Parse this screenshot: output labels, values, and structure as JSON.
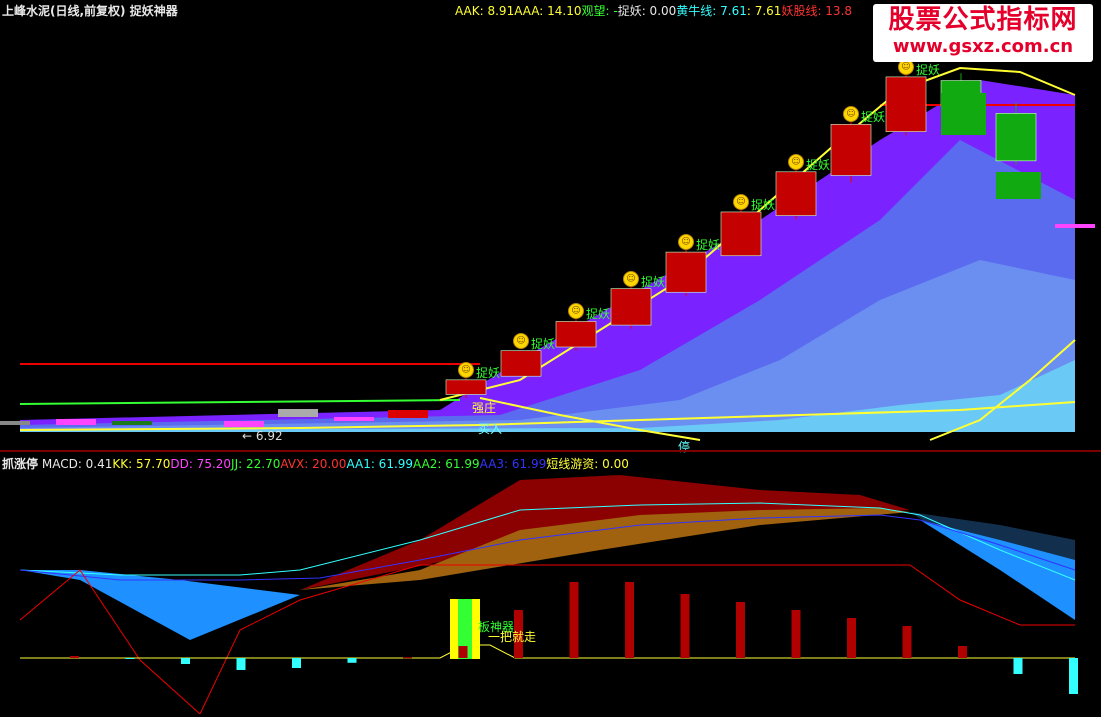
{
  "main_panel": {
    "title": "上峰水泥(日线,前复权) 捉妖神器",
    "indicators": [
      {
        "label": "AAK:",
        "value": "8.91",
        "color": "#ffff33"
      },
      {
        "label": "AAA:",
        "value": "14.10",
        "color": "#ffff33"
      },
      {
        "label": "观望:",
        "value": "-",
        "color": "#33ff33"
      },
      {
        "label": "捉妖:",
        "value": "0.00",
        "color": "#e8e8e8"
      },
      {
        "label": "黄牛线:",
        "value": "7.61",
        "color": "#33ffff"
      },
      {
        "label": ":",
        "value": "7.61",
        "color": "#ffff33"
      },
      {
        "label": "妖股线:",
        "value": "13.8",
        "color": "#ff3333"
      }
    ],
    "annotations": {
      "capture": "捉妖",
      "strong": "强庄",
      "low_price": "← 6.92",
      "stop": "停",
      "buy": "买入"
    }
  },
  "sub_panel": {
    "title": "抓涨停",
    "indicators": [
      {
        "label": "MACD:",
        "value": "0.41",
        "color": "#e8e8e8"
      },
      {
        "label": "KK:",
        "value": "57.70",
        "color": "#ffff33"
      },
      {
        "label": "DD:",
        "value": "75.20",
        "color": "#ff44ff"
      },
      {
        "label": "JJ:",
        "value": "22.70",
        "color": "#33ff33"
      },
      {
        "label": "AVX:",
        "value": "20.00",
        "color": "#ff3333"
      },
      {
        "label": "AA1:",
        "value": "61.99",
        "color": "#33ffff"
      },
      {
        "label": "AA2:",
        "value": "61.99",
        "color": "#33ff33"
      },
      {
        "label": "AA3:",
        "value": "61.99",
        "color": "#3333ff"
      },
      {
        "label": "短线游资:",
        "value": "0.00",
        "color": "#ffff33"
      }
    ],
    "annotations": {
      "god": "板神器",
      "grab": "一把就走"
    }
  },
  "watermark": {
    "title": "股票公式指标网",
    "url": "www.gsxz.com.cn"
  },
  "chart_data": {
    "type": "candlestick",
    "candles": [
      {
        "open": 7.2,
        "close": 7.6,
        "high": 7.8,
        "low": 7.1
      },
      {
        "open": 7.7,
        "close": 8.4,
        "high": 8.4,
        "low": 7.7
      },
      {
        "open": 8.5,
        "close": 9.2,
        "high": 9.3,
        "low": 8.4
      },
      {
        "open": 9.1,
        "close": 10.1,
        "high": 10.2,
        "low": 9.0
      },
      {
        "open": 10.0,
        "close": 11.1,
        "high": 11.2,
        "low": 9.9
      },
      {
        "open": 11.0,
        "close": 12.2,
        "high": 12.3,
        "low": 11.0
      },
      {
        "open": 12.1,
        "close": 13.3,
        "high": 13.4,
        "low": 12.0
      },
      {
        "open": 13.2,
        "close": 14.6,
        "high": 14.8,
        "low": 13.0
      },
      {
        "open": 14.4,
        "close": 15.9,
        "high": 16.0,
        "low": 14.3
      },
      {
        "open": 15.8,
        "close": 15.1,
        "high": 16.0,
        "low": 15.0
      },
      {
        "open": 14.9,
        "close": 13.6,
        "high": 15.2,
        "low": 13.5
      }
    ],
    "macd_bars": [
      0.05,
      -0.02,
      -0.15,
      -0.3,
      -0.25,
      -0.12,
      0.02,
      0.3,
      1.2,
      1.9,
      1.9,
      1.6,
      1.4,
      1.2,
      1.0,
      0.8,
      0.3,
      -0.4,
      -0.9
    ]
  }
}
